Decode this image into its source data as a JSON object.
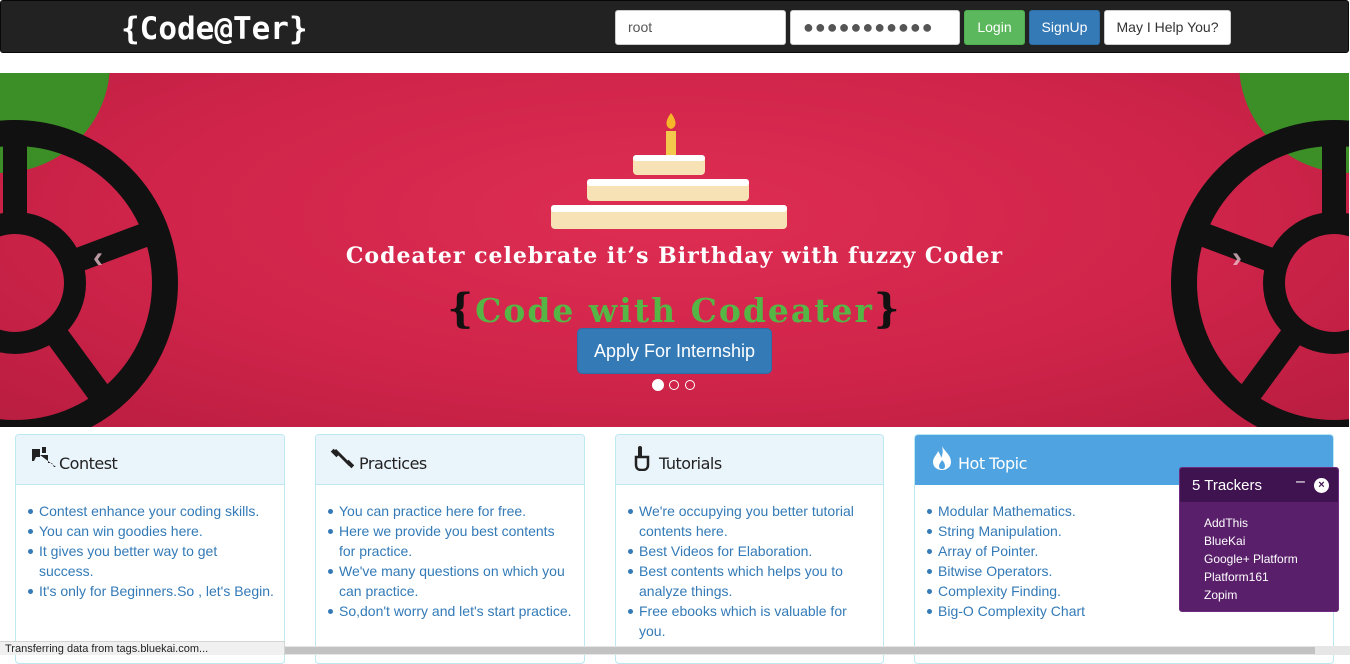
{
  "navbar": {
    "brand": "{Code@Ter}",
    "username_value": "root",
    "password_value": "●●●●●●●●●●●",
    "login_label": "Login",
    "signup_label": "SignUp",
    "help_label": "May I Help You?"
  },
  "carousel": {
    "headline": "Codeater celebrate it’s Birthday with fuzzy Coder",
    "tagline_open": "{",
    "tagline_text": "Code with Codeater",
    "tagline_close": "}",
    "cta_label": "Apply For Internship",
    "prev_arrow": "‹",
    "next_arrow": "›",
    "slides_total": 3,
    "active_slide": 1
  },
  "panels": [
    {
      "title": "Contest",
      "icon": "thumbs-icon",
      "items": [
        "Contest enhance your coding skills.",
        "You can win goodies here.",
        "It gives you better way to get success.",
        "It's only for Beginners.So , let's Begin."
      ]
    },
    {
      "title": "Practices",
      "icon": "dumbbell-icon",
      "items": [
        "You can practice here for free.",
        "Here we provide you best contents for practice.",
        "We've many questions on which you can practice.",
        "So,don't worry and let's start practice."
      ]
    },
    {
      "title": "Tutorials",
      "icon": "hand-pointer-icon",
      "items": [
        "We're occupying you better tutorial contents here.",
        "Best Videos for Elaboration.",
        "Best contents which helps you to analyze things.",
        "Free ebooks which is valuable for you."
      ]
    },
    {
      "title": "Hot Topic",
      "icon": "fire-icon",
      "items": [
        "Modular Mathematics.",
        "String Manipulation.",
        "Array of Pointer.",
        "Bitwise Operators.",
        "Complexity Finding.",
        "Big-O Complexity Chart"
      ]
    }
  ],
  "trackers": {
    "title": "5 Trackers",
    "minimize": "–",
    "close": "×",
    "items": [
      "AddThis",
      "BlueKai",
      "Google+ Platform",
      "Platform161",
      "Zopim"
    ]
  },
  "statusbar": {
    "text": "Transferring data from tags.bluekai.com..."
  },
  "colors": {
    "navbar_bg": "#222222",
    "carousel_bg": "#d2264b",
    "link_blue": "#337ab7",
    "login_green": "#5cb85c",
    "hot_topic_blue": "#4ea3e0",
    "trackers_purple": "#5a1f6b"
  }
}
